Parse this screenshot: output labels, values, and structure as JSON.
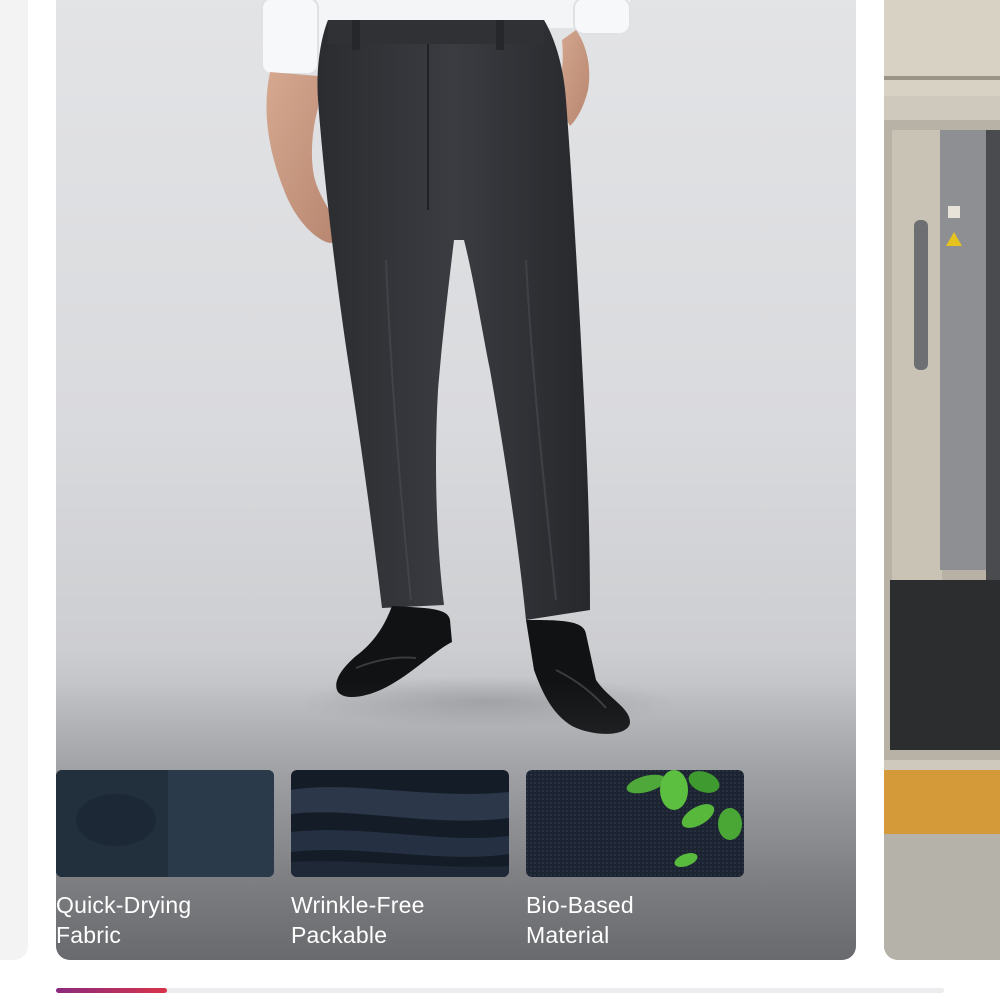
{
  "carousel": {
    "progress": 0.125,
    "accent_start": "#8a2a7f",
    "accent_end": "#d8334a"
  },
  "main_card": {
    "image_icon": "model-wearing-dark-trousers-photo",
    "features": [
      {
        "icon": "quick-drying-fabric-swatch",
        "line1": "Quick-Drying",
        "line2": "Fabric"
      },
      {
        "icon": "wrinkle-free-fabric-swatch",
        "line1": "Wrinkle-Free",
        "line2": "Packable"
      },
      {
        "icon": "bio-based-leaves-swatch",
        "line1": "Bio-Based",
        "line2": "Material"
      }
    ]
  },
  "next_card": {
    "image_icon": "subway-train-door-photo"
  }
}
